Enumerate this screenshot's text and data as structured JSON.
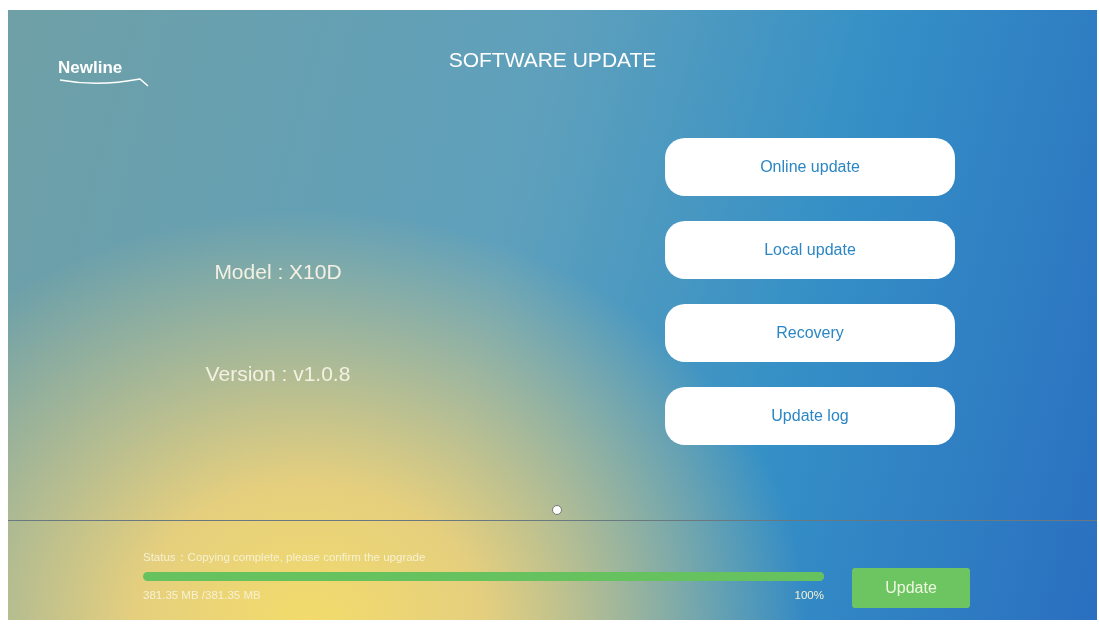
{
  "logo": "Newline",
  "title": "SOFTWARE UPDATE",
  "info": [
    {
      "text": "Model : X10D"
    },
    {
      "text": "Version : v1.0.8"
    }
  ],
  "menu_buttons": [
    "Online update",
    "Local update",
    "Recovery",
    "Update log"
  ],
  "status": {
    "text": "Status：Copying complete, please confirm the upgrade",
    "level": 1,
    "size": "381.35 MB /381.35 MB",
    "percent": "100%"
  },
  "update_button": "Update"
}
